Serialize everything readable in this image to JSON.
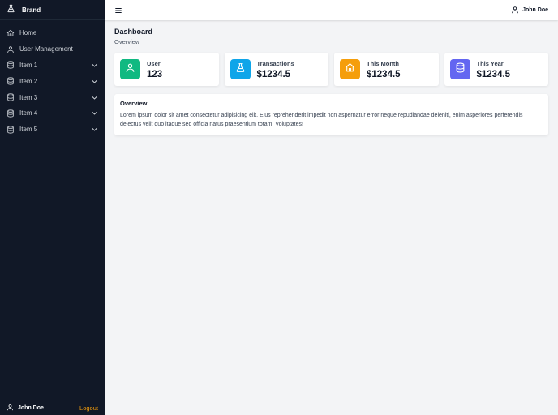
{
  "brand": {
    "name": "Brand",
    "icon": "flask-icon"
  },
  "sidebar": {
    "items": [
      {
        "label": "Home",
        "icon": "home-icon",
        "expandable": false
      },
      {
        "label": "User Management",
        "icon": "user-icon",
        "expandable": false
      },
      {
        "label": "Item 1",
        "icon": "database-icon",
        "expandable": true
      },
      {
        "label": "Item 2",
        "icon": "database-icon",
        "expandable": true
      },
      {
        "label": "Item 3",
        "icon": "database-icon",
        "expandable": true
      },
      {
        "label": "Item 4",
        "icon": "database-icon",
        "expandable": true
      },
      {
        "label": "Item 5",
        "icon": "database-icon",
        "expandable": true
      }
    ],
    "footer": {
      "user_name": "John Doe",
      "logout_label": "Logout"
    }
  },
  "topbar": {
    "user_name": "John Doe",
    "menu_icon": "hamburger-icon"
  },
  "page": {
    "title": "Dashboard",
    "subtitle": "Overview"
  },
  "cards": [
    {
      "title": "User",
      "value": "123",
      "color": "#10b981",
      "icon": "user-icon"
    },
    {
      "title": "Transactions",
      "value": "$1234.5",
      "color": "#0ea5e9",
      "icon": "flask-icon"
    },
    {
      "title": "This Month",
      "value": "$1234.5",
      "color": "#f59e0b",
      "icon": "home-icon"
    },
    {
      "title": "This Year",
      "value": "$1234.5",
      "color": "#6366f1",
      "icon": "database-icon"
    }
  ],
  "overview": {
    "title": "Overview",
    "text": "Lorem ipsum dolor sit amet consectetur adipisicing elit. Eius reprehenderit impedit non aspernatur error neque repudiandae deleniti, enim asperiores perferendis delectus velit quo itaque sed officia natus praesentium totam. Voluptates!"
  },
  "colors": {
    "sidebar_bg": "#111827",
    "logout": "#f59e0b",
    "page_bg": "#f3f4f6"
  }
}
